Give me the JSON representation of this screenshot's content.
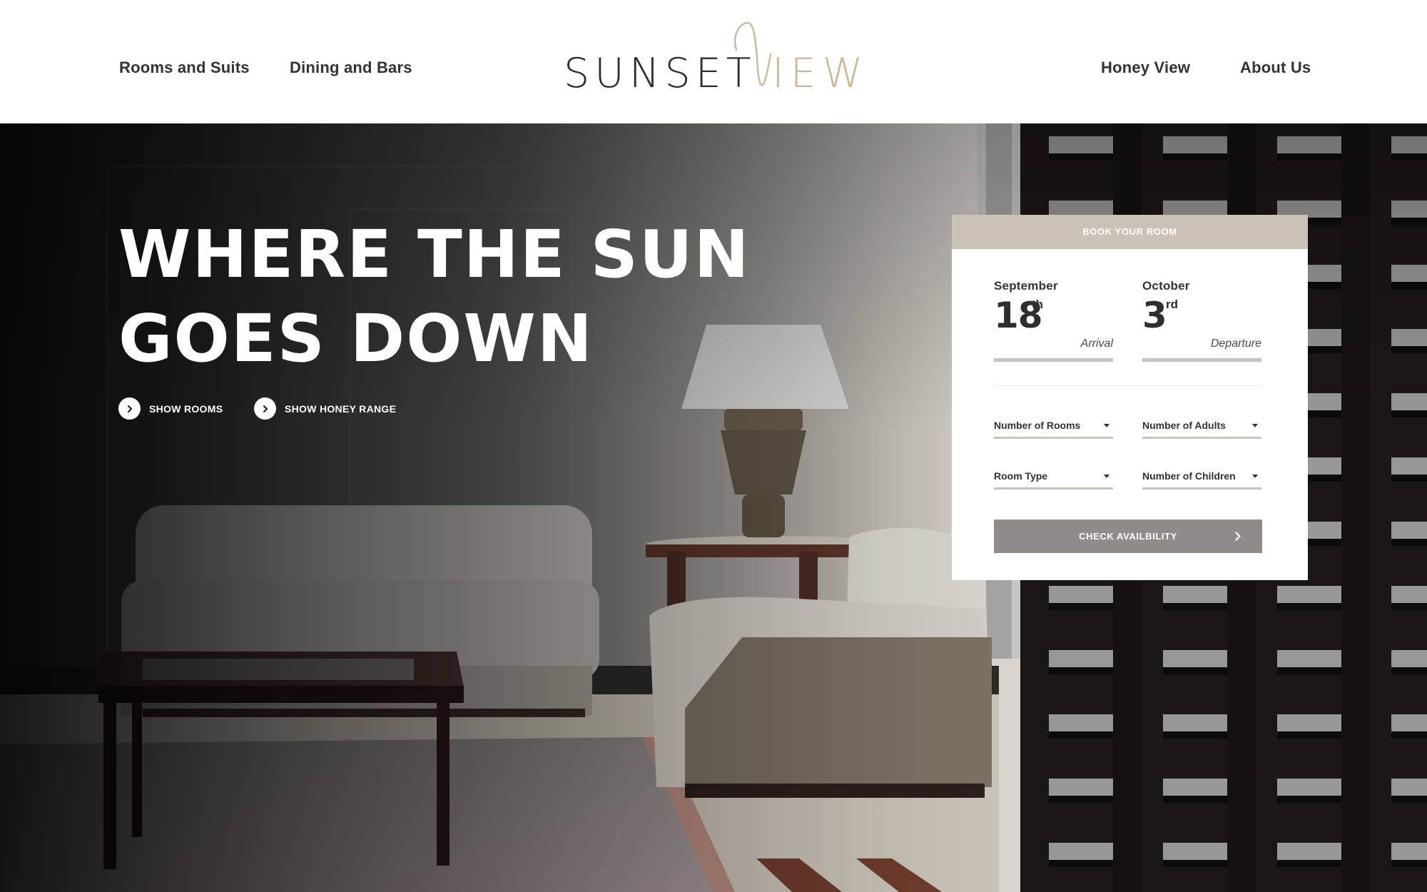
{
  "header": {
    "nav_left": [
      {
        "label": "Rooms and Suits"
      },
      {
        "label": "Dining and Bars"
      }
    ],
    "logo": {
      "word1": "SUNSET",
      "word2_rest": "IEW",
      "word2_initial": "V",
      "accent_color": "#c9b99a"
    },
    "nav_right": [
      {
        "label": "Honey View"
      },
      {
        "label": "About Us"
      }
    ]
  },
  "hero": {
    "title_line1": "WHERE THE SUN",
    "title_line2": "GOES DOWN",
    "ctas": [
      {
        "label": "SHOW ROOMS",
        "icon": "chevron-right-icon"
      },
      {
        "label": "SHOW HONEY RANGE",
        "icon": "chevron-right-icon"
      }
    ]
  },
  "booking": {
    "title": "BOOK YOUR ROOM",
    "arrival": {
      "month": "September",
      "day": "18",
      "suffix": "th",
      "label": "Arrival"
    },
    "departure": {
      "month": "October",
      "day": "3",
      "suffix": "rd",
      "label": "Departure"
    },
    "selects": [
      {
        "label": "Number of Rooms"
      },
      {
        "label": "Number of Adults"
      },
      {
        "label": "Room Type"
      },
      {
        "label": "Number of Children"
      }
    ],
    "submit_label": "CHECK AVAILBILITY",
    "colors": {
      "header_bg": "#cbc2b7",
      "button_bg": "#918c87",
      "underline": "#cbc2b7"
    }
  }
}
